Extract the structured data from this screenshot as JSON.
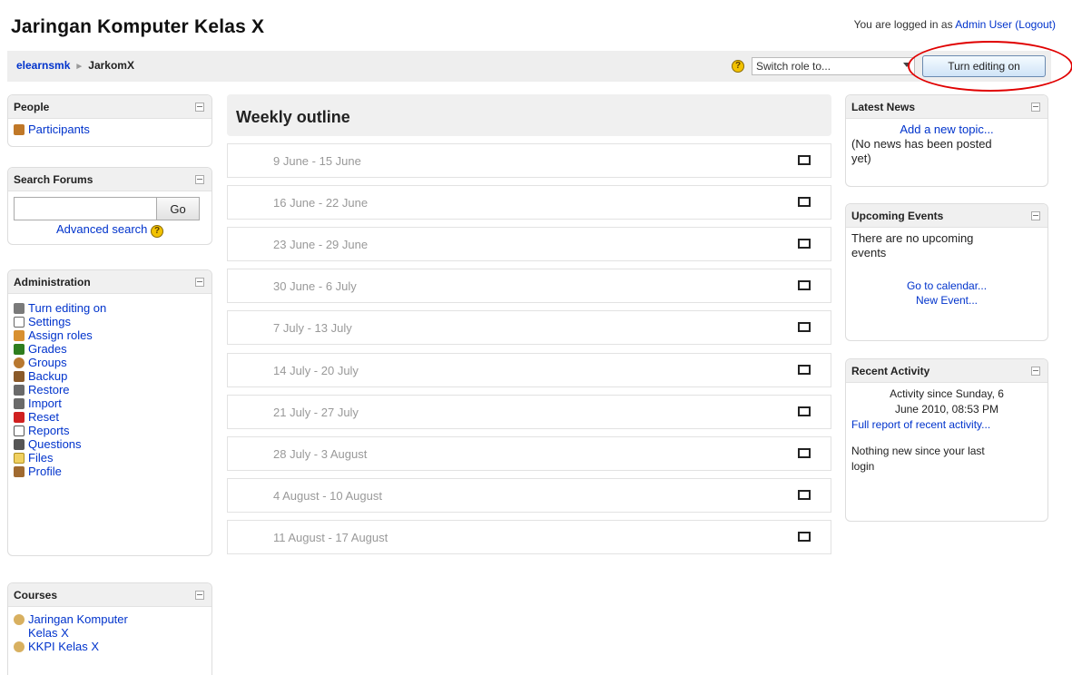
{
  "header": {
    "title": "Jaringan Komputer Kelas X",
    "login_prefix": "You are logged in as ",
    "user_name": "Admin User",
    "logout": "(Logout)"
  },
  "navbar": {
    "breadcrumb_home": "elearnsmk",
    "breadcrumb_sep": "►",
    "breadcrumb_current": "JarkomX",
    "role_select_value": "Switch role to...",
    "edit_button": "Turn editing on"
  },
  "people": {
    "title": "People",
    "participants": "Participants"
  },
  "search_forums": {
    "title": "Search Forums",
    "go_label": "Go",
    "advanced": "Advanced search"
  },
  "administration": {
    "title": "Administration",
    "items": [
      "Turn editing on",
      "Settings",
      "Assign roles",
      "Grades",
      "Groups",
      "Backup",
      "Restore",
      "Import",
      "Reset",
      "Reports",
      "Questions",
      "Files",
      "Profile"
    ]
  },
  "courses": {
    "title": "Courses",
    "items": [
      "Jaringan Komputer",
      "Kelas X",
      "KKPI Kelas X"
    ]
  },
  "outline": {
    "title": "Weekly outline",
    "weeks": [
      "9 June - 15 June",
      "16 June - 22 June",
      "23 June - 29 June",
      "30 June - 6 July",
      "7 July - 13 July",
      "14 July - 20 July",
      "21 July - 27 July",
      "28 July - 3 August",
      "4 August - 10 August",
      "11 August - 17 August"
    ]
  },
  "latest_news": {
    "title": "Latest News",
    "add_topic": "Add a new topic...",
    "empty_line1": "(No news has been posted",
    "empty_line2": "yet)"
  },
  "upcoming_events": {
    "title": "Upcoming Events",
    "empty_line1": "There are no upcoming",
    "empty_line2": "events",
    "go_calendar": "Go to calendar...",
    "new_event": "New Event..."
  },
  "recent_activity": {
    "title": "Recent Activity",
    "since_line1": "Activity since Sunday, 6",
    "since_line2": "June 2010, 08:53 PM",
    "full_report": "Full report of recent activity...",
    "nothing_line1": "Nothing new since your last",
    "nothing_line2": "login"
  },
  "colors": {
    "link": "#0033cc",
    "annotation": "#e00000",
    "week_text": "#999999"
  }
}
